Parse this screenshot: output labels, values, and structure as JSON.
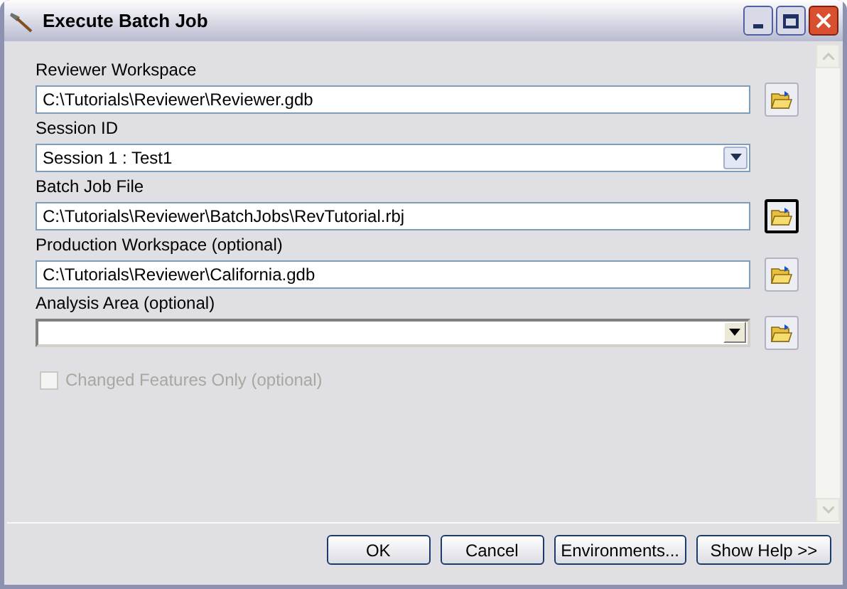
{
  "window": {
    "title": "Execute Batch Job"
  },
  "parameters": [
    {
      "label": "Reviewer Workspace",
      "kind": "text",
      "value": "C:\\Tutorials\\Reviewer\\Reviewer.gdb",
      "browse": true,
      "focused": false
    },
    {
      "label": "Session ID",
      "kind": "dropdown",
      "value": "Session 1 : Test1",
      "browse": false,
      "focused": false
    },
    {
      "label": "Batch Job File",
      "kind": "text",
      "value": "C:\\Tutorials\\Reviewer\\BatchJobs\\RevTutorial.rbj",
      "browse": true,
      "focused": true
    },
    {
      "label": "Production Workspace (optional)",
      "kind": "text",
      "value": "C:\\Tutorials\\Reviewer\\California.gdb",
      "browse": true,
      "focused": false
    },
    {
      "label": "Analysis Area (optional)",
      "kind": "combo",
      "browse": true,
      "focused": false
    }
  ],
  "option": {
    "label": "Changed Features Only (optional)",
    "checked": false,
    "disabled": true
  },
  "buttons": [
    "OK",
    "Cancel",
    "Environments...",
    "Show Help >>"
  ]
}
